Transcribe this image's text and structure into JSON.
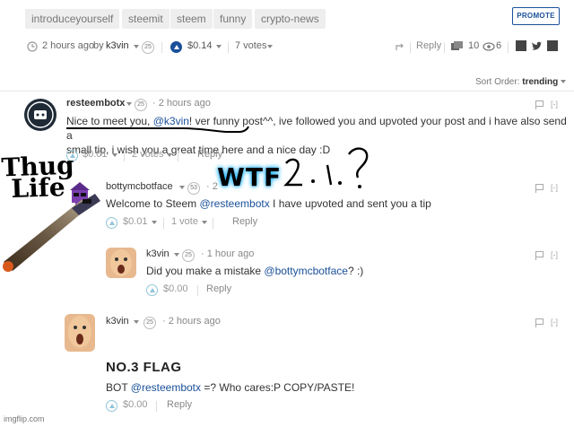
{
  "tags": [
    "introduceyourself",
    "steemit",
    "steem",
    "funny",
    "crypto-news"
  ],
  "promote_label": "PROMOTE",
  "post_meta": {
    "time": "2 hours ago",
    "by_label": "by",
    "author": "k3vin",
    "rep": "25",
    "payout": "$0.14",
    "votes": "7 votes",
    "reply_label": "Reply",
    "comments_count": "10",
    "views_count": "6"
  },
  "sort": {
    "label": "Sort Order:",
    "value": "trending"
  },
  "comments": [
    {
      "author": "resteembotx",
      "rep": "25",
      "time": "2 hours ago",
      "text_pre": "Nice to meet you, ",
      "mention": "@k3vin",
      "text_post": "! ver funny post^^, ive followed you and upvoted your post and i have also send a",
      "text_line2": "small tip, i wish you a great time here and a nice day :D",
      "payout": "$0.01",
      "votes": "2 votes",
      "reply_label": "Reply"
    },
    {
      "author": "bottymcbotface",
      "rep": "53",
      "time": "2",
      "text_pre": "Welcome to Steem ",
      "mention": "@resteembotx",
      "text_post": " I have upvoted and sent you a tip",
      "payout": "$0.01",
      "votes": "1 vote",
      "reply_label": "Reply"
    },
    {
      "author": "k3vin",
      "rep": "25",
      "time": "1 hour ago",
      "text_pre": "Did you make a mistake ",
      "mention": "@bottymcbotface",
      "text_post": "? :)",
      "payout": "$0.00",
      "reply_label": "Reply"
    },
    {
      "author": "k3vin",
      "rep": "25",
      "time": "2 hours ago",
      "heading": "NO.3 FLAG",
      "text_pre": "BOT ",
      "mention": "@resteembotx",
      "text_post": " =? Who cares:P COPY/PASTE!",
      "payout": "$0.00",
      "reply_label": "Reply"
    }
  ],
  "overlay": {
    "thug_line1": "Thug",
    "thug_line2": "Life",
    "wtf": "WTF",
    "scribble": "2.1?"
  },
  "collapse_label": "[-]",
  "watermark": "imgflip.com",
  "colors": {
    "accent": "#1a5099",
    "link": "#1a5099",
    "upvote_light": "#8fc5d8"
  },
  "icons": [
    "clock-icon",
    "upvote-icon",
    "share-icon",
    "comments-icon",
    "eye-icon",
    "facebook-icon",
    "twitter-icon",
    "linkedin-icon",
    "flag-icon"
  ]
}
